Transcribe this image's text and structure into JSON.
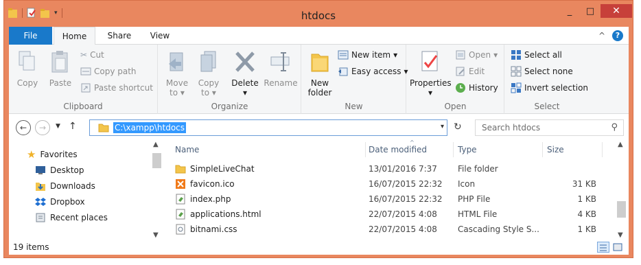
{
  "window": {
    "title": "htdocs"
  },
  "titlebar": {
    "min_label": "_",
    "max_label": "□",
    "close_label": "✕"
  },
  "tabs": {
    "file": "File",
    "home": "Home",
    "share": "Share",
    "view": "View",
    "collapse": "^",
    "help": "?"
  },
  "ribbon": {
    "clipboard": {
      "label": "Clipboard",
      "copy": "Copy",
      "paste": "Paste",
      "cut": "Cut",
      "copy_path": "Copy path",
      "paste_shortcut": "Paste shortcut"
    },
    "organize": {
      "label": "Organize",
      "move_to": "Move",
      "move_to2": "to",
      "copy_to": "Copy",
      "copy_to2": "to",
      "delete": "Delete",
      "rename": "Rename"
    },
    "new": {
      "label": "New",
      "new_folder": "New",
      "new_folder2": "folder",
      "new_item": "New item",
      "easy_access": "Easy access"
    },
    "open": {
      "label": "Open",
      "properties": "Properties",
      "open": "Open",
      "edit": "Edit",
      "history": "History"
    },
    "select": {
      "label": "Select",
      "select_all": "Select all",
      "select_none": "Select none",
      "invert_selection": "Invert selection"
    }
  },
  "address": {
    "path": "C:\\xampp\\htdocs",
    "search_placeholder": "Search htdocs"
  },
  "nav": {
    "items": [
      {
        "label": "Favorites",
        "icon": "star-icon"
      },
      {
        "label": "Desktop",
        "icon": "desktop-icon"
      },
      {
        "label": "Downloads",
        "icon": "downloads-icon"
      },
      {
        "label": "Dropbox",
        "icon": "dropbox-icon"
      },
      {
        "label": "Recent places",
        "icon": "recent-places-icon"
      }
    ]
  },
  "files": {
    "columns": {
      "name": "Name",
      "date": "Date modified",
      "type": "Type",
      "size": "Size"
    },
    "rows": [
      {
        "name": "SimpleLiveChat",
        "date": "13/01/2016 7:37",
        "type": "File folder",
        "size": "",
        "icon": "folder-icon"
      },
      {
        "name": "favicon.ico",
        "date": "16/07/2015 22:32",
        "type": "Icon",
        "size": "31 KB",
        "icon": "ico-file-icon"
      },
      {
        "name": "index.php",
        "date": "16/07/2015 22:32",
        "type": "PHP File",
        "size": "1 KB",
        "icon": "php-file-icon"
      },
      {
        "name": "applications.html",
        "date": "22/07/2015 4:08",
        "type": "HTML File",
        "size": "4 KB",
        "icon": "html-file-icon"
      },
      {
        "name": "bitnami.css",
        "date": "22/07/2015 4:08",
        "type": "Cascading Style S...",
        "size": "1 KB",
        "icon": "css-file-icon"
      }
    ]
  },
  "status": {
    "count": "19 items"
  },
  "colors": {
    "frame": "#e9875f",
    "accent": "#1979ca",
    "close": "#c7403a",
    "selection": "#3399ff"
  }
}
